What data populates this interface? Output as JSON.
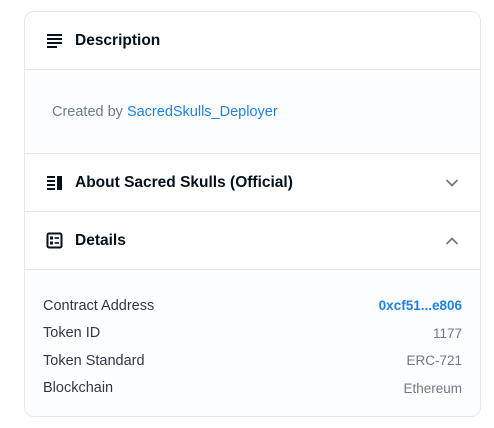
{
  "description": {
    "title": "Description",
    "created_by_prefix": "Created by",
    "creator_name": "SacredSkulls_Deployer"
  },
  "about": {
    "title": "About Sacred Skulls (Official)"
  },
  "details": {
    "title": "Details",
    "rows": [
      {
        "label": "Contract Address",
        "value": "0xcf51...e806"
      },
      {
        "label": "Token ID",
        "value": "1177"
      },
      {
        "label": "Token Standard",
        "value": "ERC-721"
      },
      {
        "label": "Blockchain",
        "value": "Ethereum"
      }
    ]
  },
  "colors": {
    "link": "#2081e2",
    "heading": "#04111d",
    "muted": "#707a83",
    "border": "#e5e8eb"
  },
  "icons": {
    "description": "subject-lines-icon",
    "about": "vertical-split-icon",
    "details": "ballot-icon",
    "about_toggle": "chevron-down-icon",
    "details_toggle": "chevron-up-icon"
  }
}
